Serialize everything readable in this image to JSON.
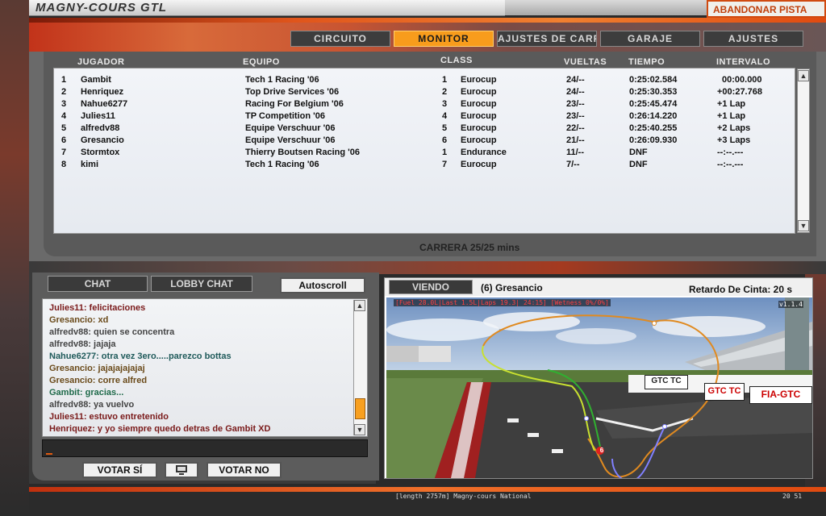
{
  "window": {
    "title": "MAGNY-COURS GTL",
    "abandon_label": "ABANDONAR PISTA"
  },
  "tabs": [
    {
      "label": "CIRCUITO",
      "active": false
    },
    {
      "label": "MONITOR",
      "active": true
    },
    {
      "label": "AJUSTES DE CARRERA",
      "active": false
    },
    {
      "label": "GARAJE",
      "active": false
    },
    {
      "label": "AJUSTES",
      "active": false
    }
  ],
  "results": {
    "headers": {
      "jugador": "JUGADOR",
      "equipo": "EQUIPO",
      "class": "CLASS",
      "vueltas": "VUELTAS",
      "tiempo": "TIEMPO",
      "intervalo": "INTERVALO"
    },
    "rows": [
      {
        "pos": "1",
        "player": "Gambit",
        "team": "Tech 1 Racing '06",
        "class_pos": "1",
        "class": "Eurocup",
        "laps": "24/--",
        "time": "0:25:02.584",
        "interval": "00:00.000"
      },
      {
        "pos": "2",
        "player": "Henriquez",
        "team": "Top Drive Services '06",
        "class_pos": "2",
        "class": "Eurocup",
        "laps": "24/--",
        "time": "0:25:30.353",
        "interval": "+00:27.768"
      },
      {
        "pos": "3",
        "player": "Nahue6277",
        "team": "Racing For Belgium '06",
        "class_pos": "3",
        "class": "Eurocup",
        "laps": "23/--",
        "time": "0:25:45.474",
        "interval": "+1 Lap"
      },
      {
        "pos": "4",
        "player": "Julies11",
        "team": "TP Competition '06",
        "class_pos": "4",
        "class": "Eurocup",
        "laps": "23/--",
        "time": "0:26:14.220",
        "interval": "+1 Lap"
      },
      {
        "pos": "5",
        "player": "alfredv88",
        "team": "Equipe Verschuur '06",
        "class_pos": "5",
        "class": "Eurocup",
        "laps": "22/--",
        "time": "0:25:40.255",
        "interval": "+2 Laps"
      },
      {
        "pos": "6",
        "player": "Gresancio",
        "team": "Equipe Verschuur '06",
        "class_pos": "6",
        "class": "Eurocup",
        "laps": "21/--",
        "time": "0:26:09.930",
        "interval": "+3 Laps"
      },
      {
        "pos": "7",
        "player": "Stormtox",
        "team": "Thierry Boutsen Racing '06",
        "class_pos": "1",
        "class": "Endurance",
        "laps": "11/--",
        "time": "DNF",
        "interval": "--:--.---"
      },
      {
        "pos": "8",
        "player": "kimi",
        "team": "Tech 1 Racing '06",
        "class_pos": "7",
        "class": "Eurocup",
        "laps": "7/--",
        "time": "DNF",
        "interval": "--:--.---"
      }
    ],
    "race_status": "CARRERA   25/25 mins"
  },
  "chat": {
    "tab_chat": "CHAT",
    "tab_lobby": "LOBBY CHAT",
    "autoscroll": "Autoscroll",
    "messages": [
      {
        "text": "Julies11: felicitaciones",
        "color": "#7a1a1a"
      },
      {
        "text": "Gresancio: xd",
        "color": "#6a4a1a"
      },
      {
        "text": "alfredv88: quien se concentra",
        "color": "#444444"
      },
      {
        "text": "alfredv88: jajaja",
        "color": "#444444"
      },
      {
        "text": "Nahue6277: otra vez 3ero.....parezco bottas",
        "color": "#1f5a5a"
      },
      {
        "text": "Gresancio: jajajajajajaj",
        "color": "#6a4a1a"
      },
      {
        "text": "Gresancio: corre alfred",
        "color": "#6a4a1a"
      },
      {
        "text": "Gambit: gracias...",
        "color": "#1f6a4a"
      },
      {
        "text": "alfredv88: ya vuelvo",
        "color": "#444444"
      },
      {
        "text": "Julies11: estuvo entretenido",
        "color": "#7a1a1a"
      },
      {
        "text": "Henriquez: y yo siempre quedo detras de Gambit XD",
        "color": "#7a1a1a"
      }
    ],
    "vote_yes": "VOTAR SÍ",
    "vote_no": "VOTAR NO"
  },
  "viewer": {
    "viewing_label": "VIENDO",
    "driver": "(6) Gresancio",
    "tape_delay": "Retardo De Cinta: 20 s",
    "hud_text": "[Fuel 28.0L|Last 1.5L|Laps 19.3| 24:15] [Wetness 0%/0%]",
    "version": "v1.1.4",
    "car_number": "6",
    "track_info": "[length 2757m] Magny-cours National",
    "clock": "20 51",
    "banners": [
      "GTC TC",
      "GTC TC",
      "FIA-GTC",
      "GTC TC"
    ]
  },
  "colors": {
    "accent_orange": "#f89c1c",
    "brand_red": "#c0400c",
    "hud_red": "#ff4040"
  }
}
